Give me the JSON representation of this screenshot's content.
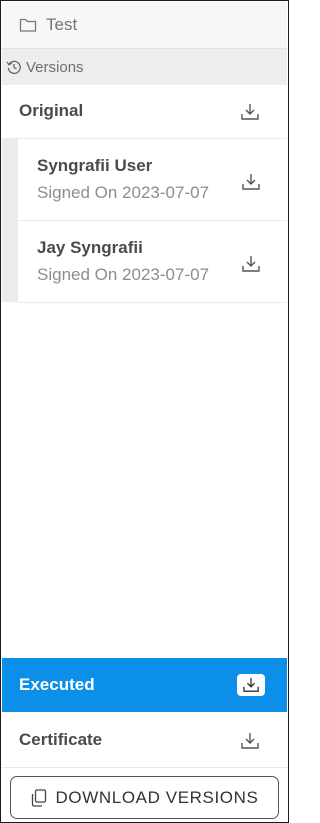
{
  "header": {
    "title": "Test",
    "icon": "folder-icon"
  },
  "versions_bar": {
    "label": "Versions",
    "icon": "history-icon"
  },
  "original": {
    "label": "Original",
    "icon": "download-icon"
  },
  "signers": [
    {
      "name": "Syngrafii User",
      "signed": "Signed On 2023-07-07"
    },
    {
      "name": "Jay Syngrafii",
      "signed": "Signed On 2023-07-07"
    }
  ],
  "executed": {
    "label": "Executed",
    "selected": true,
    "icon": "download-icon"
  },
  "certificate": {
    "label": "Certificate",
    "icon": "download-icon"
  },
  "footer": {
    "download_versions_label": "DOWNLOAD VERSIONS",
    "icon": "copy-icon"
  },
  "colors": {
    "accent": "#0b8fe8",
    "header_bg": "#f7f7f7",
    "versions_bar_bg": "#ededed"
  }
}
